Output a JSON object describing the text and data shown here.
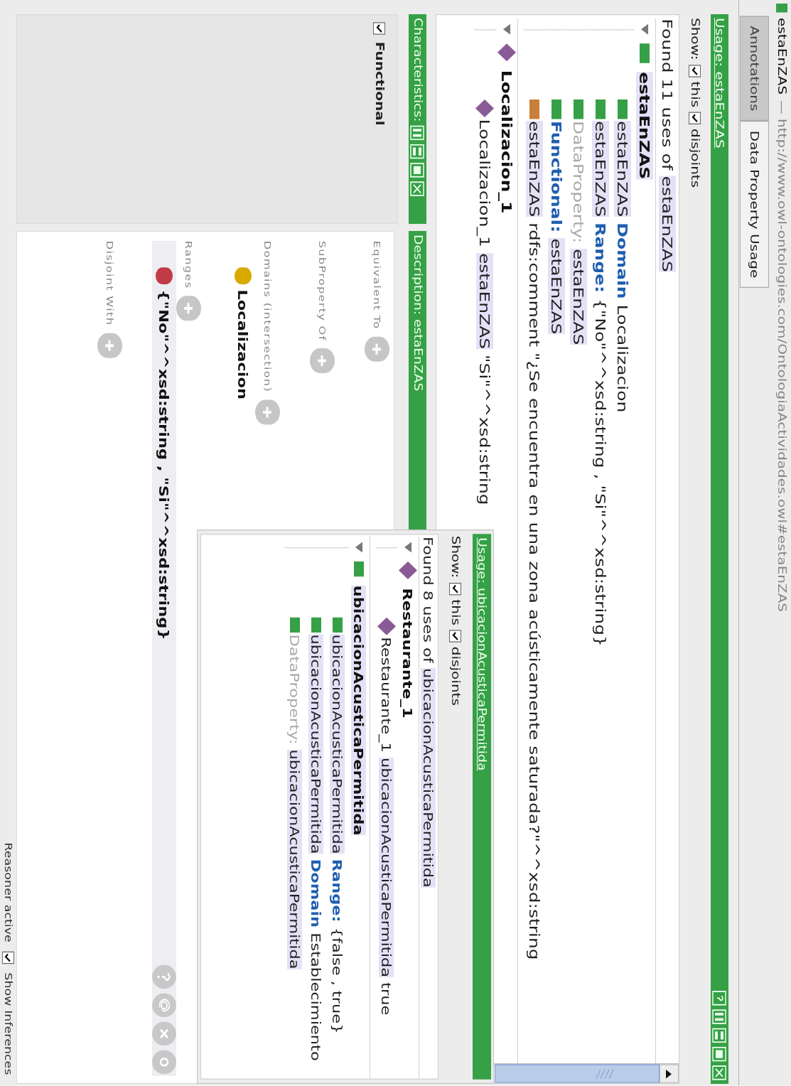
{
  "window": {
    "title": "estaEnZAS",
    "iri": "— http://www.owl-ontologies.com/OntologiaActividades.owl#estaEnZAS"
  },
  "tabs": [
    {
      "label": "Annotations",
      "selected": false
    },
    {
      "label": "Data Property Usage",
      "selected": true
    }
  ],
  "usage": {
    "title": "Usage: estaEnZAS",
    "show_label": "Show:",
    "filters": [
      {
        "label": "this",
        "checked": true
      },
      {
        "label": "disjoints",
        "checked": true
      }
    ],
    "summary": [
      {
        "text": "Found 11 uses of",
        "kind": "plain"
      },
      {
        "text": "estaEnZAS",
        "kind": "entity"
      }
    ],
    "tree": [
      {
        "kind": "property",
        "expanded": true,
        "tokens": [
          {
            "text": "estaEnZAS",
            "kind": "entity"
          }
        ],
        "children": [
          {
            "kind": "property",
            "tokens": [
              {
                "text": "estaEnZAS",
                "kind": "entity"
              },
              {
                "text": "Domain",
                "kind": "keyword"
              },
              {
                "text": "Localizacion",
                "kind": "plain"
              }
            ]
          },
          {
            "kind": "property",
            "tokens": [
              {
                "text": "estaEnZAS",
                "kind": "entity"
              },
              {
                "text": "Range:",
                "kind": "keyword"
              },
              {
                "text": "{\"No\"^^xsd:string , \"Si\"^^xsd:string}",
                "kind": "plain"
              }
            ]
          },
          {
            "kind": "property",
            "tokens": [
              {
                "text": "DataProperty:",
                "kind": "muted"
              },
              {
                "text": "estaEnZAS",
                "kind": "entity"
              }
            ]
          },
          {
            "kind": "property",
            "tokens": [
              {
                "text": "Functional:",
                "kind": "keyword"
              },
              {
                "text": "estaEnZAS",
                "kind": "entity"
              }
            ]
          },
          {
            "kind": "annotation",
            "tokens": [
              {
                "text": "estaEnZAS",
                "kind": "entity"
              },
              {
                "text": "rdfs:comment \"¿Se encuentra en una zona acústicamente saturada?\"^^xsd:string",
                "kind": "plain"
              }
            ]
          }
        ]
      },
      {
        "kind": "individual",
        "expanded": true,
        "tokens": [
          {
            "text": "Localizacion_1",
            "kind": "plain"
          }
        ],
        "children": [
          {
            "kind": "individual",
            "tokens": [
              {
                "text": "Localizacion_1",
                "kind": "plain"
              },
              {
                "text": "estaEnZAS",
                "kind": "entity"
              },
              {
                "text": "\"Si\"^^xsd:string",
                "kind": "plain"
              }
            ]
          }
        ]
      }
    ]
  },
  "characteristics": {
    "title": "Characteristics:",
    "items": [
      {
        "label": "Functional",
        "checked": true
      }
    ]
  },
  "description": {
    "title": "Description: estaEnZAS",
    "sections": [
      {
        "label": "Equivalent To"
      },
      {
        "label": "SubProperty Of"
      },
      {
        "label": "Domains (intersection)",
        "items": [
          {
            "kind": "class",
            "label": "Localizacion",
            "selected": false
          }
        ]
      },
      {
        "label": "Ranges",
        "items": [
          {
            "kind": "datatype",
            "label": "{\"No\"^^xsd:string , \"Si\"^^xsd:string}",
            "selected": true
          }
        ]
      },
      {
        "label": "Disjoint With"
      }
    ]
  },
  "usage_window": {
    "title": "Usage: ubicacionAcusticaPermitida",
    "show_label": "Show:",
    "filters": [
      {
        "label": "this",
        "checked": true
      },
      {
        "label": "disjoints",
        "checked": true
      }
    ],
    "summary": [
      {
        "text": "Found 8 uses of",
        "kind": "plain"
      },
      {
        "text": "ubicacionAcusticaPermitida",
        "kind": "entity"
      }
    ],
    "tree": [
      {
        "kind": "individual",
        "expanded": true,
        "tokens": [
          {
            "text": "Restaurante_1",
            "kind": "plain"
          }
        ],
        "children": [
          {
            "kind": "individual",
            "tokens": [
              {
                "text": "Restaurante_1",
                "kind": "plain"
              },
              {
                "text": "ubicacionAcusticaPermitida",
                "kind": "entity"
              },
              {
                "text": "true",
                "kind": "plain"
              }
            ]
          }
        ]
      },
      {
        "kind": "property",
        "expanded": true,
        "tokens": [
          {
            "text": "ubicacionAcusticaPermitida",
            "kind": "entity"
          }
        ],
        "children": [
          {
            "kind": "property",
            "tokens": [
              {
                "text": "ubicacionAcusticaPermitida",
                "kind": "entity"
              },
              {
                "text": "Range:",
                "kind": "keyword"
              },
              {
                "text": "{false , true}",
                "kind": "plain"
              }
            ]
          },
          {
            "kind": "property",
            "tokens": [
              {
                "text": "ubicacionAcusticaPermitida",
                "kind": "entity"
              },
              {
                "text": "Domain",
                "kind": "keyword"
              },
              {
                "text": "Establecimiento",
                "kind": "plain"
              }
            ]
          },
          {
            "kind": "property",
            "tokens": [
              {
                "text": "DataProperty:",
                "kind": "muted"
              },
              {
                "text": "ubicacionAcusticaPermitida",
                "kind": "entity"
              }
            ]
          }
        ]
      }
    ]
  },
  "status_bar": {
    "text": "Reasoner active",
    "show_inferences": {
      "label": "Show Inferences",
      "checked": true
    }
  }
}
